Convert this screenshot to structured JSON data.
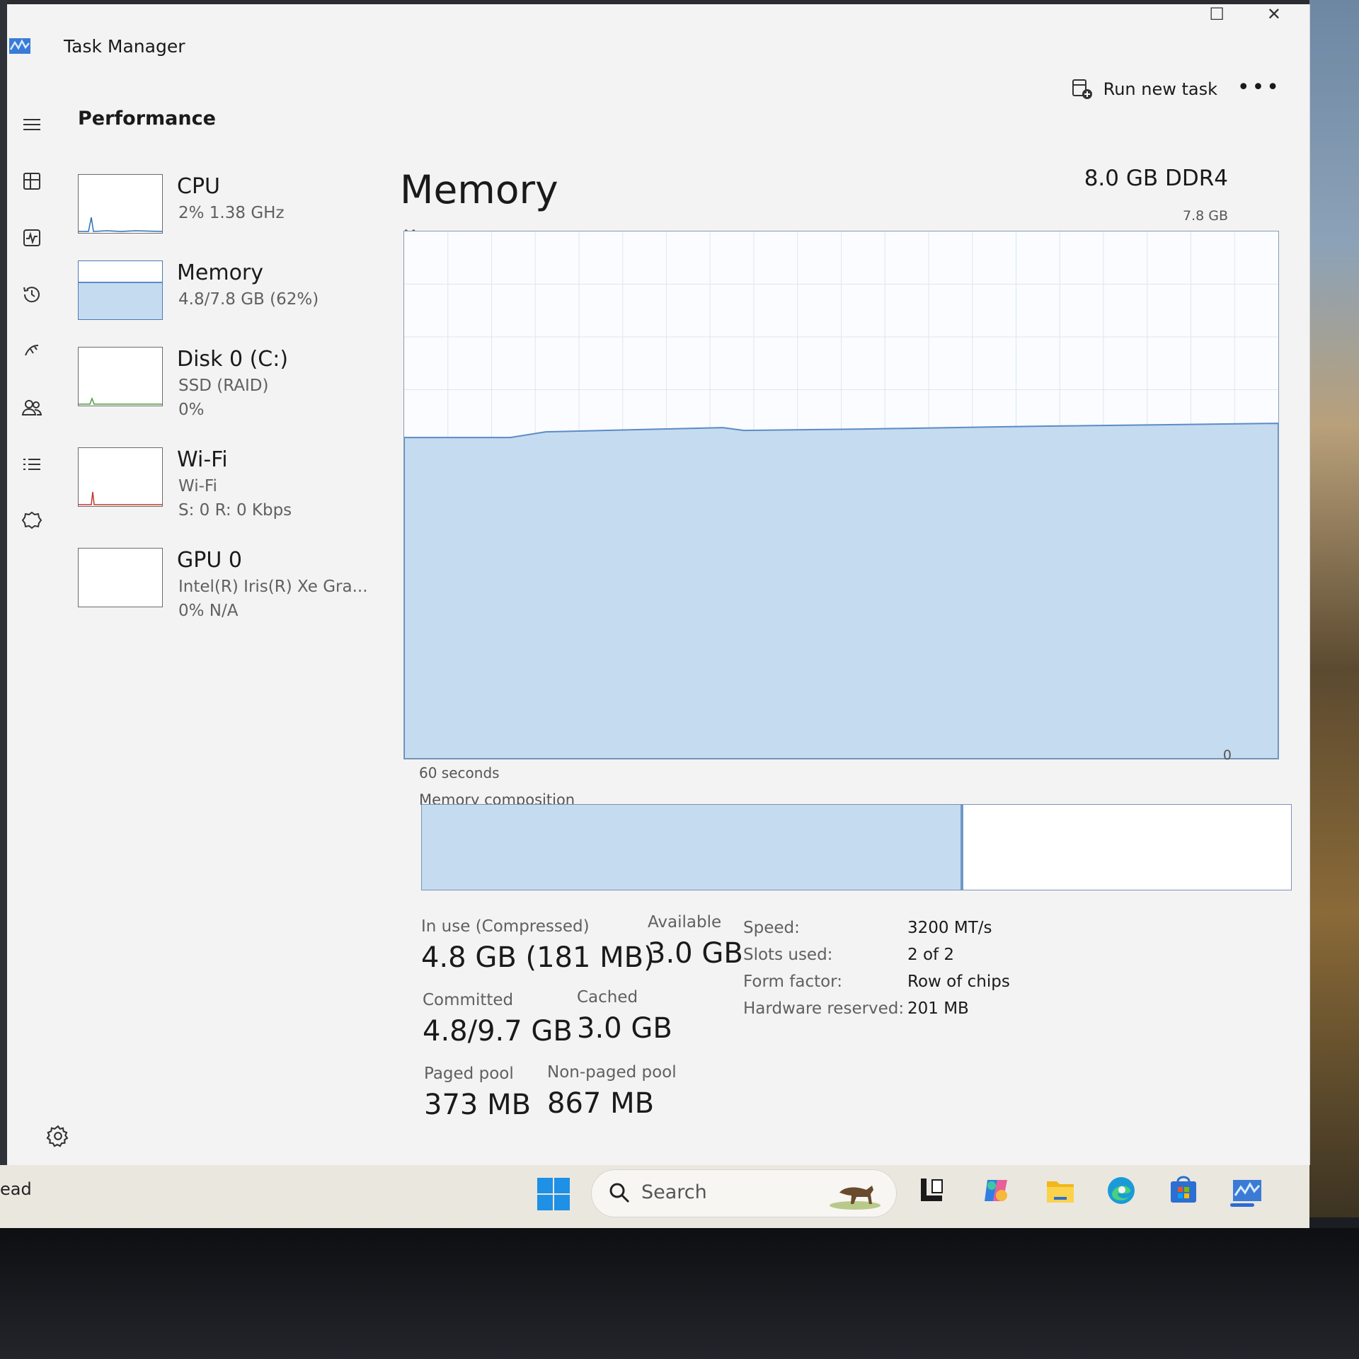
{
  "window": {
    "title": "Task Manager",
    "page_title": "Performance",
    "run_new_task_label": "Run new task",
    "more_label": "•••"
  },
  "nav": [
    {
      "name": "hamburger-menu-icon"
    },
    {
      "name": "processes-icon"
    },
    {
      "name": "performance-icon"
    },
    {
      "name": "app-history-icon"
    },
    {
      "name": "startup-apps-icon"
    },
    {
      "name": "users-icon"
    },
    {
      "name": "details-icon"
    },
    {
      "name": "services-icon"
    }
  ],
  "devices": [
    {
      "name": "CPU",
      "line1": "2%  1.38 GHz",
      "line2": ""
    },
    {
      "name": "Memory",
      "line1": "4.8/7.8 GB (62%)",
      "line2": ""
    },
    {
      "name": "Disk 0 (C:)",
      "line1": "SSD (RAID)",
      "line2": "0%"
    },
    {
      "name": "Wi-Fi",
      "line1": "Wi-Fi",
      "line2": "S: 0 R: 0 Kbps"
    },
    {
      "name": "GPU 0",
      "line1": "Intel(R) Iris(R) Xe Gra...",
      "line2": "0%  N/A"
    }
  ],
  "memory": {
    "title": "Memory",
    "spec": "8.0 GB DDR4",
    "usage_label": "Memory usage",
    "max_label": "7.8 GB",
    "time_label": "60 seconds",
    "zero_label": "0",
    "composition_label": "Memory composition",
    "composition_in_use_fraction": 0.62,
    "usage_fraction": 0.62,
    "stats": [
      {
        "key": "In use (Compressed)",
        "value": "4.8 GB (181 MB)"
      },
      {
        "key": "Available",
        "value": "3.0 GB"
      },
      {
        "key": "Committed",
        "value": "4.8/9.7 GB"
      },
      {
        "key": "Cached",
        "value": "3.0 GB"
      },
      {
        "key": "Paged pool",
        "value": "373 MB"
      },
      {
        "key": "Non-paged pool",
        "value": "867 MB"
      }
    ],
    "specs": [
      {
        "key": "Speed:",
        "value": "3200 MT/s"
      },
      {
        "key": "Slots used:",
        "value": "2 of 2"
      },
      {
        "key": "Form factor:",
        "value": "Row of chips"
      },
      {
        "key": "Hardware reserved:",
        "value": "201 MB"
      }
    ]
  },
  "taskbar": {
    "edge_text": "ead",
    "search_placeholder": "Search",
    "icons": [
      "start-icon",
      "task-view-icon",
      "copilot-icon",
      "file-explorer-icon",
      "edge-icon",
      "store-icon",
      "task-manager-icon"
    ]
  },
  "colors": {
    "memory_fill": "#c5dbef",
    "memory_line": "#5b8cc7",
    "cpu_line": "#2f6fb6",
    "wifi_line": "#c0392b"
  }
}
